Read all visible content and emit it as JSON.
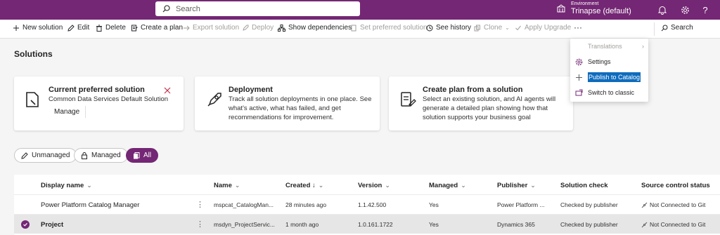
{
  "topbar": {
    "search_placeholder": "Search",
    "env_label": "Environment",
    "env_name": "Trinapse (default)"
  },
  "commands": {
    "new_solution": "New solution",
    "edit": "Edit",
    "delete": "Delete",
    "create_plan": "Create a plan",
    "export_solution": "Export solution",
    "deploy": "Deploy",
    "show_dependencies": "Show dependencies",
    "set_preferred": "Set preferred solution",
    "see_history": "See history",
    "clone": "Clone",
    "apply_upgrade": "Apply Upgrade",
    "more": "···",
    "search": "Search"
  },
  "page": {
    "title": "Solutions"
  },
  "cards": {
    "preferred": {
      "title": "Current preferred solution",
      "desc": "Common Data Services Default Solution",
      "manage": "Manage"
    },
    "deployment": {
      "title": "Deployment",
      "desc": "Track all solution deployments in one place. See what's active, what has failed, and get recommendations for improvement."
    },
    "plan": {
      "title": "Create plan from a solution",
      "desc": "Select an existing solution, and AI agents will generate a detailed plan showing how that solution supports your business goal"
    }
  },
  "menu": {
    "translations": "Translations",
    "settings": "Settings",
    "publish": "Publish to Catalog",
    "switch": "Switch to classic"
  },
  "filters": {
    "unmanaged": "Unmanaged",
    "managed": "Managed",
    "all": "All"
  },
  "table": {
    "headers": {
      "display_name": "Display name",
      "name": "Name",
      "created": "Created ↓",
      "version": "Version",
      "managed": "Managed",
      "publisher": "Publisher",
      "solution_check": "Solution check",
      "source_control": "Source control status"
    },
    "rows": [
      {
        "display_name": "Power Platform Catalog Manager",
        "name": "mspcat_CatalogMan...",
        "created": "28 minutes ago",
        "version": "1.1.42.500",
        "managed": "Yes",
        "publisher": "Power Platform ...",
        "solution_check": "Checked by publisher",
        "source_control": "Not Connected to Git"
      },
      {
        "display_name": "Project",
        "name": "msdyn_ProjectServic...",
        "created": "1 month ago",
        "version": "1.0.161.1722",
        "managed": "Yes",
        "publisher": "Dynamics 365",
        "solution_check": "Checked by publisher",
        "source_control": "Not Connected to Git"
      }
    ]
  },
  "colors": {
    "brand": "#742774",
    "highlight": "#0f6cbd"
  }
}
